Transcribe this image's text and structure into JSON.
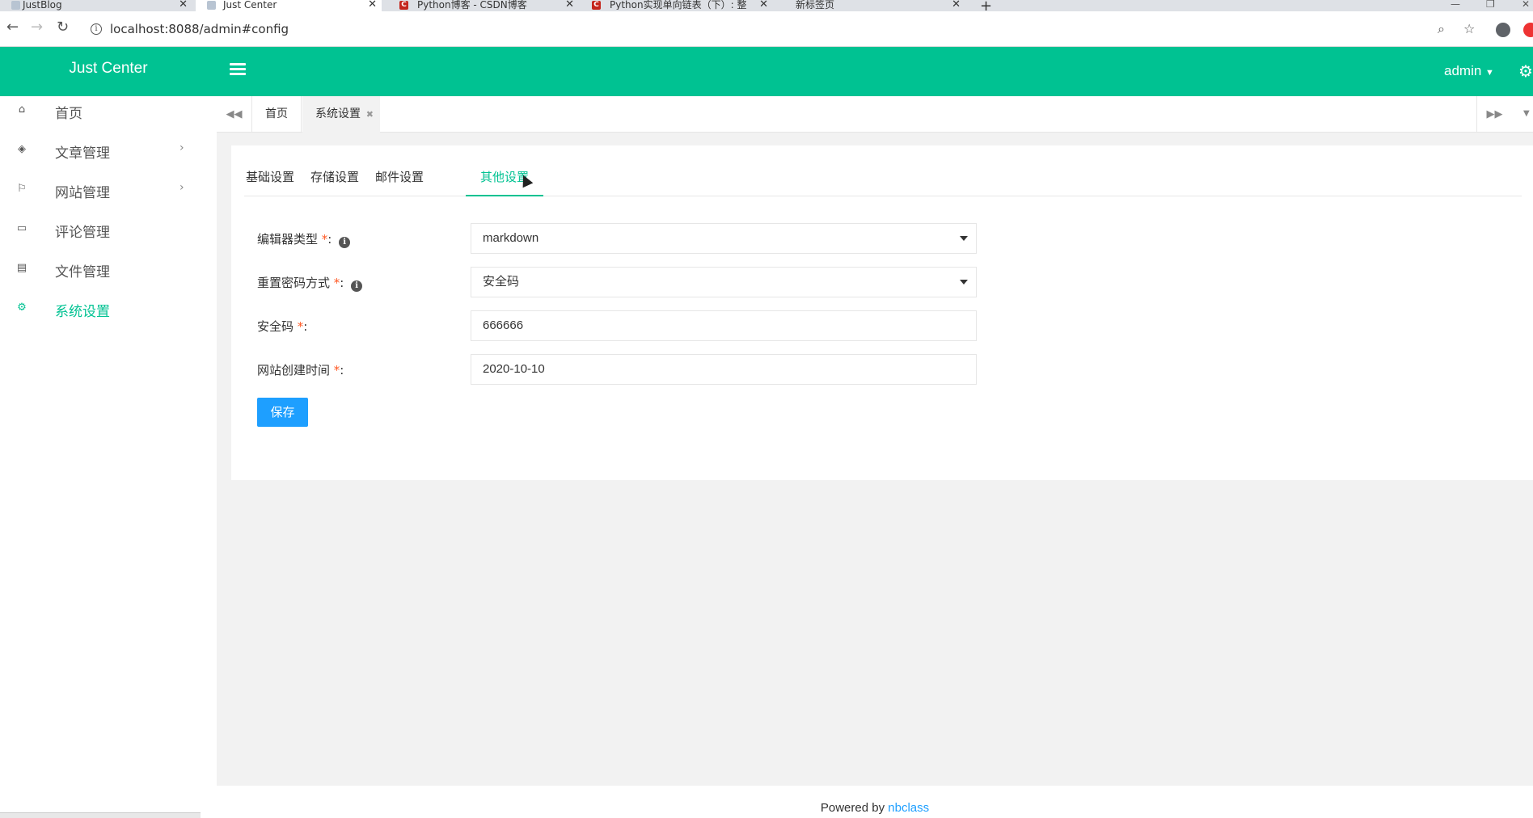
{
  "browser": {
    "tabs": [
      {
        "title": "JustBlog",
        "active": false
      },
      {
        "title": "Just Center",
        "active": true
      },
      {
        "title": "Python博客 - CSDN博客",
        "active": false
      },
      {
        "title": "Python实现单向链表（下）: 整",
        "active": false
      },
      {
        "title": "新标签页",
        "active": false
      }
    ],
    "url": "localhost:8088/admin#config"
  },
  "app": {
    "logo": "Just Center",
    "user": "admin"
  },
  "sidebar": {
    "items": [
      {
        "label": "首页",
        "icon": "home-icon"
      },
      {
        "label": "文章管理",
        "icon": "layers-icon"
      },
      {
        "label": "网站管理",
        "icon": "flag-icon"
      },
      {
        "label": "评论管理",
        "icon": "comment-icon"
      },
      {
        "label": "文件管理",
        "icon": "file-icon"
      },
      {
        "label": "系统设置",
        "icon": "gear-icon"
      }
    ]
  },
  "content_tabs": {
    "home": "首页",
    "current": "系统设置"
  },
  "settings_tabs": [
    "基础设置",
    "存储设置",
    "邮件设置",
    "其他设置"
  ],
  "form": {
    "editor_type": {
      "label": "编辑器类型",
      "value": "markdown"
    },
    "reset_method": {
      "label": "重置密码方式",
      "value": "安全码"
    },
    "security_code": {
      "label": "安全码",
      "value": "666666"
    },
    "site_created": {
      "label": "网站创建时间",
      "value": "2020-10-10"
    },
    "save_label": "保存"
  },
  "footer": {
    "prefix": "Powered by ",
    "link": "nbclass"
  },
  "colors": {
    "accent": "#00c292",
    "primary_button": "#1e9fff",
    "required": "#ff5722"
  }
}
